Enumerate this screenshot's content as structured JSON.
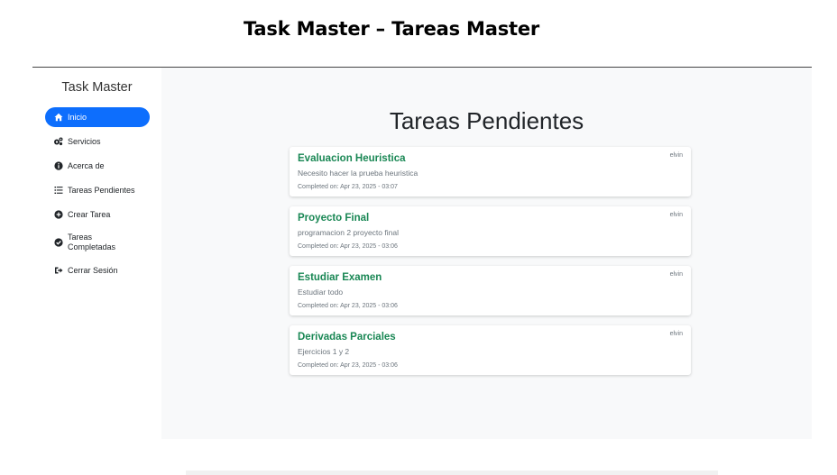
{
  "document": {
    "title": "Task Master – Tareas Master"
  },
  "sidebar": {
    "brand": "Task Master",
    "items": [
      {
        "label": "Inicio",
        "icon": "home-icon",
        "active": true
      },
      {
        "label": "Servicios",
        "icon": "gears-icon"
      },
      {
        "label": "Acerca de",
        "icon": "info-circle-icon"
      },
      {
        "label": "Tareas Pendientes",
        "icon": "list-icon"
      },
      {
        "label": "Crear Tarea",
        "icon": "plus-circle-icon"
      },
      {
        "label": "Tareas Completadas",
        "icon": "check-circle-icon"
      },
      {
        "label": "Cerrar Sesión",
        "icon": "sign-out-icon"
      }
    ]
  },
  "main": {
    "title": "Tareas Pendientes",
    "tasks": [
      {
        "title": "Evaluacion Heuristica",
        "description": "Necesito hacer la prueba heuristica",
        "completed": "Completed on: Apr 23, 2025 - 03:07",
        "user": "elvin"
      },
      {
        "title": "Proyecto Final",
        "description": "programacion 2 proyecto final",
        "completed": "Completed on: Apr 23, 2025 - 03:06",
        "user": "elvin"
      },
      {
        "title": "Estudiar Examen",
        "description": "Estudiar todo",
        "completed": "Completed on: Apr 23, 2025 - 03:06",
        "user": "elvin"
      },
      {
        "title": "Derivadas Parciales",
        "description": "Ejercicios 1 y 2",
        "completed": "Completed on: Apr 23, 2025 - 03:06",
        "user": "elvin"
      }
    ]
  },
  "colors": {
    "accent": "#0d6efd",
    "task_title": "#198754",
    "main_bg": "#f8f9fa"
  }
}
